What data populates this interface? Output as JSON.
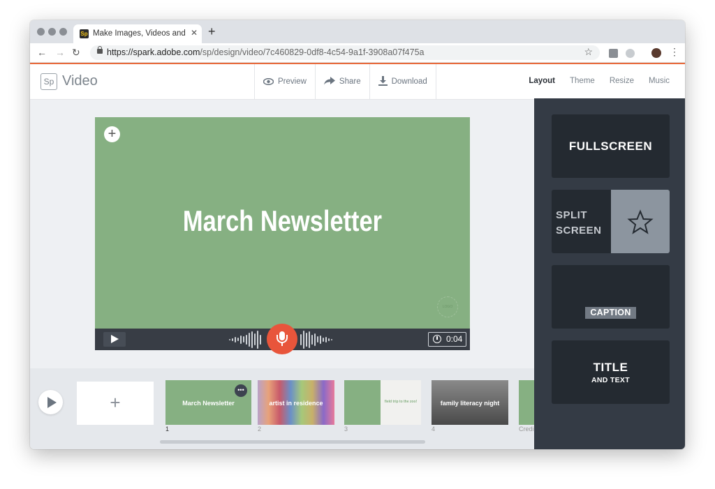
{
  "browser": {
    "tab_title": "Make Images, Videos and Web",
    "tab_favicon": "Sp",
    "url_host": "https://spark.adobe.com",
    "url_path": "/sp/design/video/7c460829-0df8-4c54-9a1f-3908a07f475a"
  },
  "app": {
    "logo_mark": "Sp",
    "product": "Video",
    "actions": [
      {
        "label": "Preview",
        "icon": "eye-icon"
      },
      {
        "label": "Share",
        "icon": "share-arrow-icon"
      },
      {
        "label": "Download",
        "icon": "download-icon"
      }
    ],
    "right_tabs": [
      {
        "label": "Layout",
        "active": true
      },
      {
        "label": "Theme",
        "active": false
      },
      {
        "label": "Resize",
        "active": false
      },
      {
        "label": "Music",
        "active": false
      }
    ],
    "accent_color": "#e86a3c"
  },
  "stage": {
    "title": "March Newsletter",
    "background_color": "#86b082",
    "logo_badge": "LOGO",
    "timer": "0:04",
    "mic_color": "#e8553b"
  },
  "timeline": {
    "slides": [
      {
        "number": "1",
        "title": "March Newsletter",
        "color": "#86b082",
        "selected": true
      },
      {
        "number": "2",
        "title": "artist in residence",
        "color": "#a08a9a"
      },
      {
        "number": "3",
        "title": "field trip to the zoo!",
        "color": "#86b082"
      },
      {
        "number": "4",
        "title": "family literacy night",
        "color": "#6b6b6b"
      },
      {
        "number": "Credi",
        "title": "",
        "color": "#86b082"
      }
    ]
  },
  "layouts": {
    "fullscreen": "FULLSCREEN",
    "split_line1": "SPLIT",
    "split_line2": "SCREEN",
    "caption": "CAPTION",
    "title_line1": "TITLE",
    "title_line2": "AND TEXT"
  }
}
